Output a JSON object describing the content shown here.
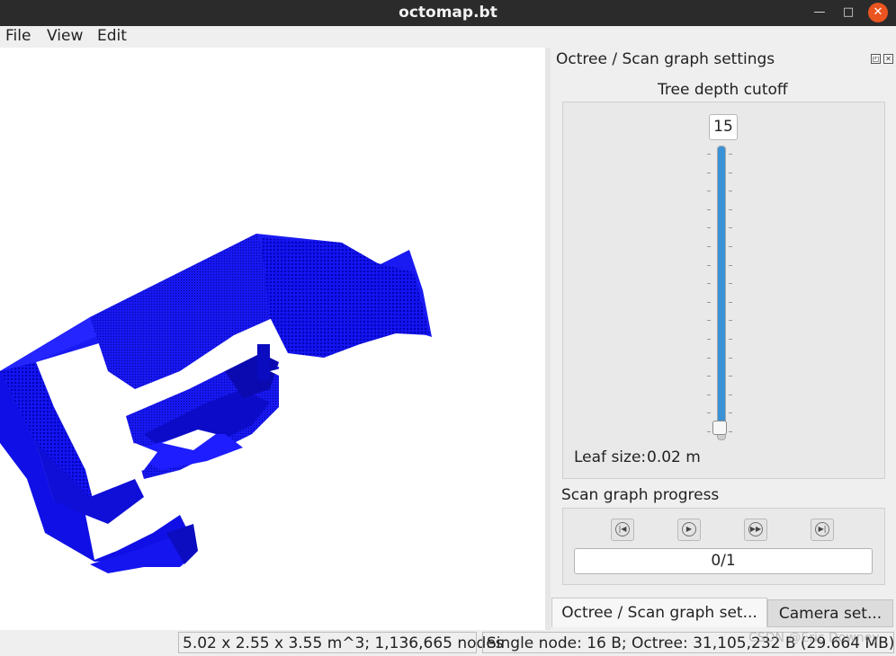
{
  "window": {
    "title": "octomap.bt"
  },
  "menu": {
    "file": "File",
    "view": "View",
    "edit": "Edit"
  },
  "dock": {
    "title": "Octree / Scan graph settings",
    "tree_depth_label": "Tree depth cutoff",
    "depth_value": "15",
    "depth_level": 0.04,
    "leaf_size_label": "Leaf size:",
    "leaf_size_value": "0.02 m",
    "scan_graph_label": "Scan graph progress",
    "progress_text": "0/1"
  },
  "tabs": {
    "octree": "Octree / Scan graph set...",
    "camera": "Camera set..."
  },
  "status": {
    "dims": "5.02 x 2.55 x 3.55 m^3; 1,136,665 nodes",
    "memory": "Single node: 16 B; Octree: 31,105,232 B (29.664 MB)"
  },
  "watermark": "CSDN @Eric Downey",
  "icons": [
    "restore-icon",
    "close-icon",
    "skip-back-icon",
    "play-icon",
    "fast-forward-icon",
    "skip-end-icon"
  ],
  "colors": {
    "voxel": "#1010e8",
    "slider_fill": "#3a92d6",
    "close_button": "#e95420"
  }
}
